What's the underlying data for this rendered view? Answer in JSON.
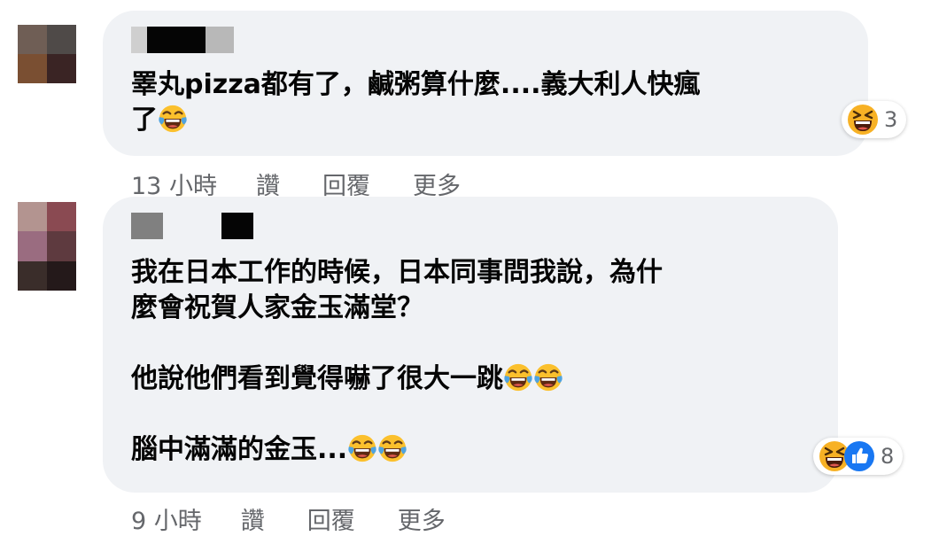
{
  "comments": [
    {
      "avatar_colors": [
        "#6f5e55",
        "#4f4a48",
        "#7a4f32",
        "#3a2424"
      ],
      "name_colors": [
        "#cfcfcf",
        "#050505",
        "#b8b8b8"
      ],
      "lines": [
        "睪丸pizza都有了，鹹粥算什麼....義大利人快瘋",
        "了"
      ],
      "reaction_count": "3",
      "time": "13 小時",
      "like": "讚",
      "reply": "回覆",
      "more": "更多"
    },
    {
      "avatar_colors": [
        "#b39490",
        "#8a4a52",
        "#9a6c80",
        "#5e3a3f",
        "#3a2d2a",
        "#24191a"
      ],
      "name_colors": [
        "#808080",
        "#e6e6e6",
        "#050505"
      ],
      "lines": [
        "我在日本工作的時候，日本同事問我說，為什",
        "麼會祝賀人家金玉滿堂？",
        "他說他們看到覺得嚇了很大一跳",
        "腦中滿滿的金玉..."
      ],
      "reaction_count": "8",
      "time": "9 小時",
      "like": "讚",
      "reply": "回覆",
      "more": "更多"
    }
  ],
  "icons": {
    "laughing_tears": "face-with-tears-of-joy-icon",
    "grin_squint": "grinning-squinting-face-icon",
    "like": "thumbs-up-icon"
  },
  "colors": {
    "bubble": "#f0f2f5",
    "meta_text": "#65676b",
    "like_blue": "#1877f2",
    "emoji_yellow": "#f7b125"
  }
}
